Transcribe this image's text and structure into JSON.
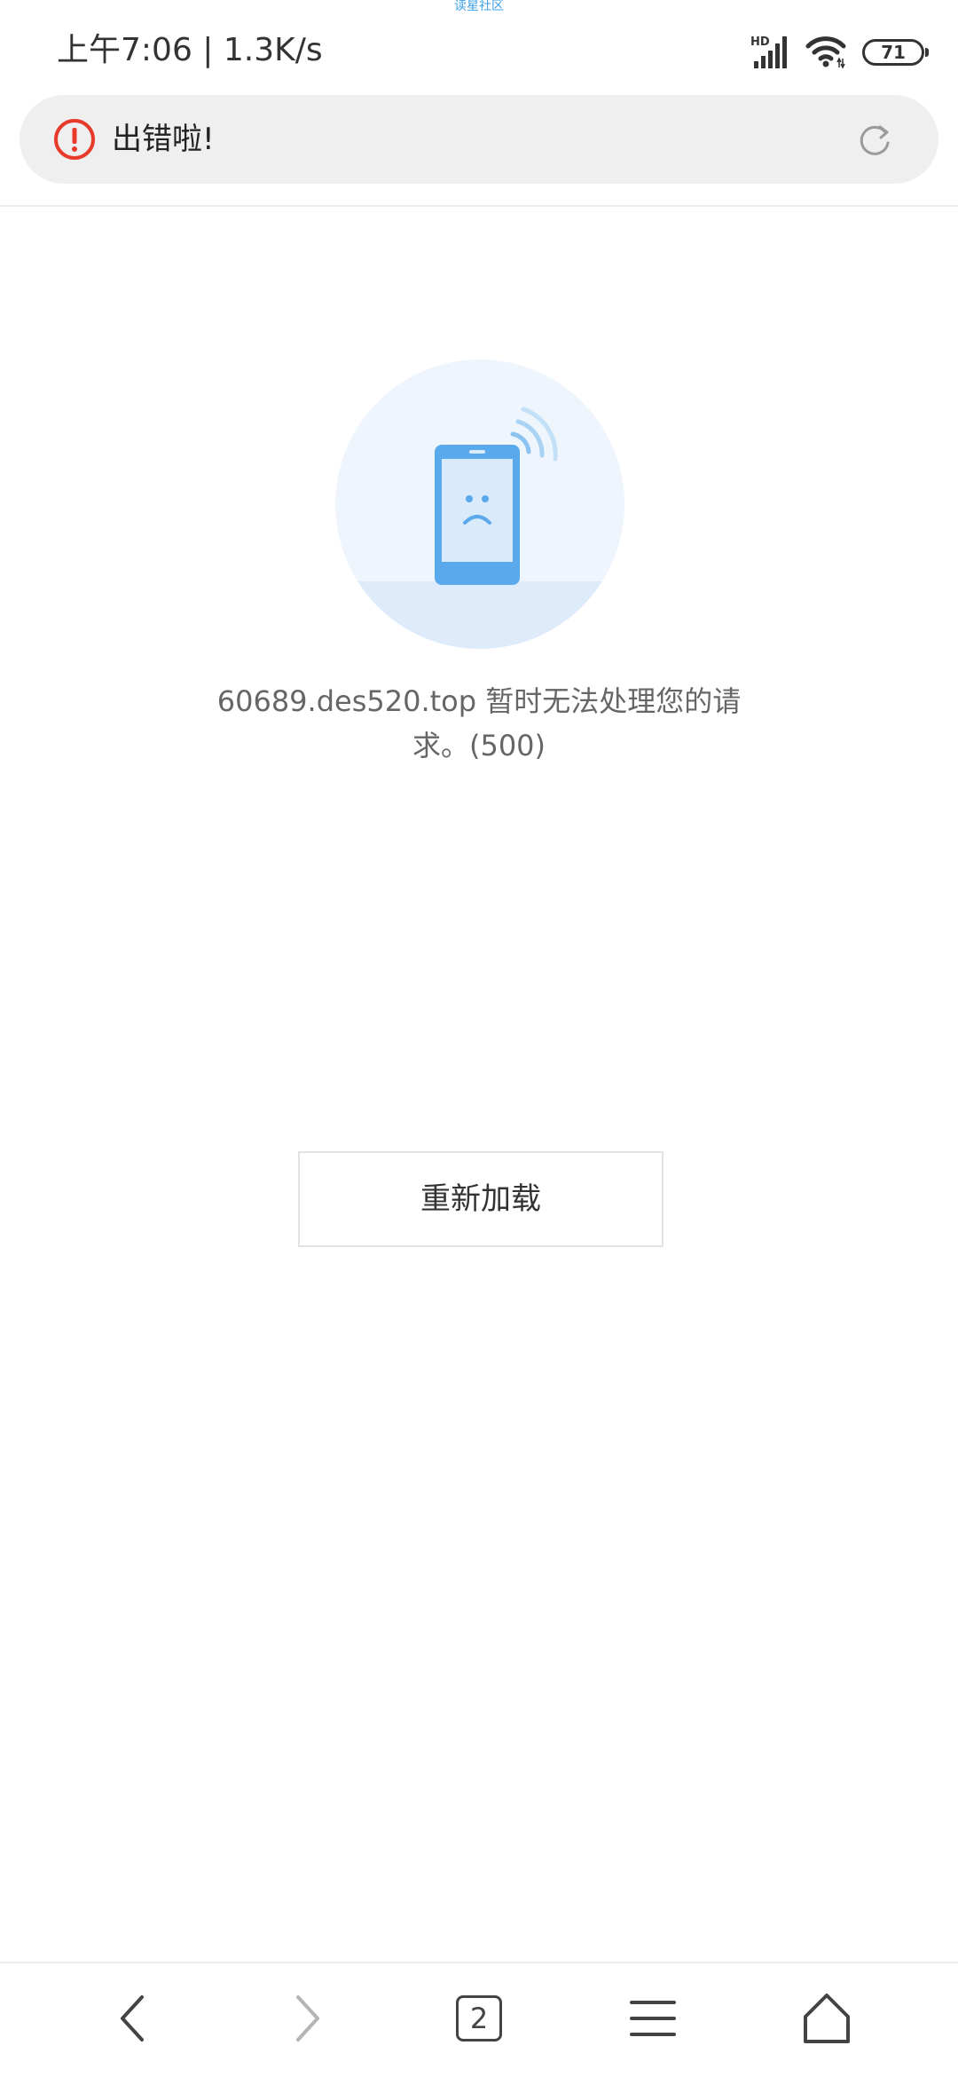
{
  "watermark": "读星社区",
  "status_bar": {
    "time_speed": "上午7:06 | 1.3K/s",
    "network_label": "HD",
    "battery": "71"
  },
  "address_bar": {
    "title": "出错啦!",
    "error_color": "#e8392b"
  },
  "error_page": {
    "message": "60689.des520.top 暂时无法处理您的请求。(500)",
    "reload_label": "重新加载",
    "illustration_color": "#5aa9ec"
  },
  "bottom_nav": {
    "tab_count": "2"
  }
}
